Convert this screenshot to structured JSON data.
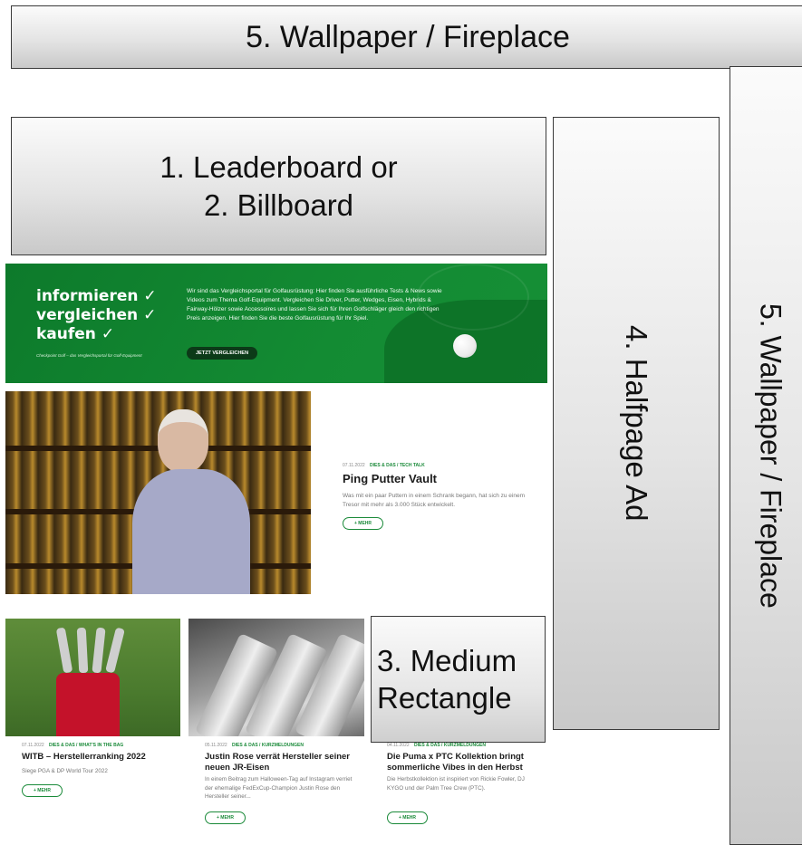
{
  "ads": {
    "wallpaper_top": "5. Wallpaper / Fireplace",
    "wallpaper_side": "5. Wallpaper / Fireplace",
    "leaderboard_line1": "1. Leaderboard or",
    "leaderboard_line2": "2. Billboard",
    "halfpage": "4. Halfpage Ad",
    "medium_line1": "3. Medium",
    "medium_line2": "Rectangle"
  },
  "hero": {
    "claims": [
      "informieren ✓",
      "vergleichen ✓",
      "kaufen ✓"
    ],
    "tagline": "Checkpoint Golf – das Vergleichsportal für Golf-Equipment",
    "description": "Wir sind das Vergleichsportal für Golfausrüstung: Hier finden Sie ausführliche Tests & News sowie Videos zum Thema Golf-Equipment. Vergleichen Sie Driver, Putter, Wedges, Eisen, Hybrids & Fairway-Hölzer sowie Accessoires und lassen Sie sich für Ihren Golfschläger gleich den richtigen Preis anzeigen. Hier finden Sie die beste Golfausrüstung für Ihr Spiel.",
    "cta": "JETZT VERGLEICHEN",
    "colors": {
      "background": "#138b33",
      "cta_bg": "#0c3a18"
    }
  },
  "featured": {
    "date": "07.11.2022",
    "category": "DIES & DAS / TECH TALK",
    "title": "Ping Putter Vault",
    "text": "Was mit ein paar Puttern in einem Schrank begann, hat sich zu einem Tresor mit mehr als 3.000 Stück entwickelt.",
    "more": "+ MEHR"
  },
  "cards": [
    {
      "date": "07.11.2022",
      "category": "DIES & DAS / WHAT'S IN THE BAG",
      "title": "WITB – Herstellerranking 2022",
      "text": "Siege PGA & DP World Tour 2022",
      "more": "+ MEHR"
    },
    {
      "date": "05.11.2022",
      "category": "DIES & DAS / KURZMELDUNGEN",
      "title": "Justin Rose verrät Hersteller seiner neuen JR-Eisen",
      "text": "In einem Beitrag zum Halloween-Tag auf Instagram verriet der ehemalige FedExCup-Champion Justin Rose den Hersteller seiner...",
      "more": "+ MEHR"
    },
    {
      "date": "04.11.2022",
      "category": "DIES & DAS / KURZMELDUNGEN",
      "title": "Die Puma x PTC Kollektion bringt sommerliche Vibes in den Herbst",
      "text": "Die Herbstkollektion ist inspiriert von Rickie Fowler, DJ KYGO und der Palm Tree Crew (PTC).",
      "more": "+ MEHR"
    }
  ],
  "colors": {
    "accent": "#1a8a39"
  }
}
